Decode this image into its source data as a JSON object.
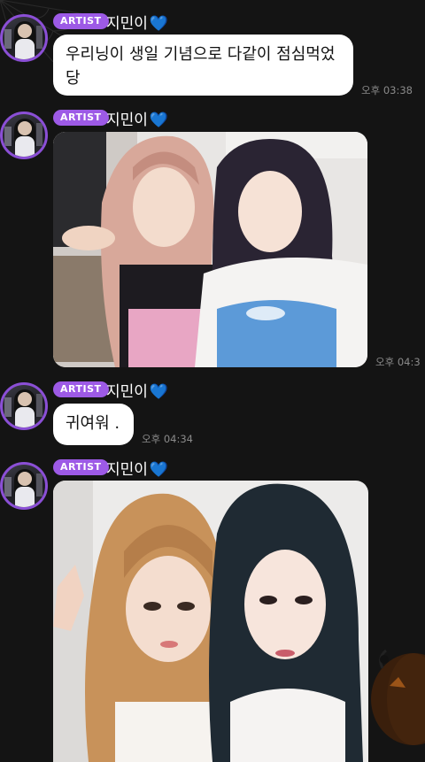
{
  "messages": [
    {
      "badge": "ARTIST",
      "sender": "지민이",
      "heart": "💙",
      "text": "우리닝이 생일 기념으로 다같이 점심먹었당",
      "time": "오후 03:38"
    },
    {
      "badge": "ARTIST",
      "sender": "지민이",
      "heart": "💙",
      "type": "photo",
      "time": "오후 04:3"
    },
    {
      "badge": "ARTIST",
      "sender": "지민이",
      "heart": "💙",
      "text": "귀여워 .",
      "time": "오후 04:34"
    },
    {
      "badge": "ARTIST",
      "sender": "지민이",
      "heart": "💙",
      "type": "photo"
    }
  ],
  "colors": {
    "background": "#141414",
    "badge": "#9d5ae6",
    "avatar_ring": "#8b4fd6",
    "heart": "#2e78ff",
    "bubble": "#ffffff",
    "timestamp": "#8a8a8a"
  },
  "icons": [
    "spider-web-icon",
    "pumpkin-icon",
    "blue-heart-icon"
  ]
}
